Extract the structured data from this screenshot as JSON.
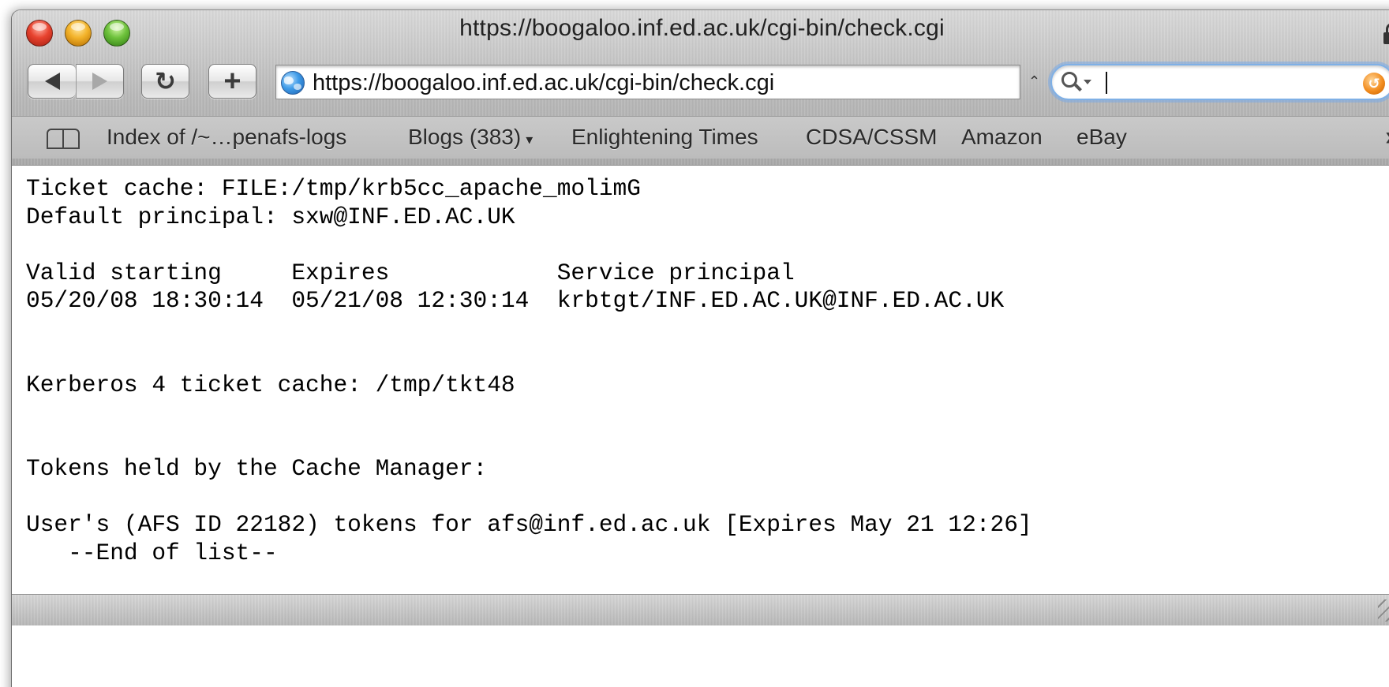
{
  "window": {
    "title": "https://boogaloo.inf.ed.ac.uk/cgi-bin/check.cgi",
    "title_icon": "lock-icon"
  },
  "toolbar": {
    "back_icon": "arrow-left-icon",
    "forward_icon": "arrow-right-icon",
    "reload_label": "↻",
    "add_label": "+",
    "url": "https://boogaloo.inf.ed.ac.uk/cgi-bin/check.cgi",
    "url_icon": "globe-icon",
    "search_value": "",
    "search_icon": "magnifier-icon",
    "snapback_icon": "snapback-icon"
  },
  "bookmarks": {
    "icon": "book-icon",
    "items": [
      "Index of /~…penafs-logs",
      "Blogs (383)",
      "Enlightening Times",
      "CDSA/CSSM",
      "Amazon",
      "eBay"
    ],
    "blogs_dropdown": "▾",
    "overflow": "»"
  },
  "content": {
    "lines": [
      "Ticket cache: FILE:/tmp/krb5cc_apache_molimG",
      "Default principal: sxw@INF.ED.AC.UK",
      "",
      "Valid starting     Expires            Service principal",
      "05/20/08 18:30:14  05/21/08 12:30:14  krbtgt/INF.ED.AC.UK@INF.ED.AC.UK",
      "",
      "",
      "Kerberos 4 ticket cache: /tmp/tkt48",
      "",
      "",
      "Tokens held by the Cache Manager:",
      "",
      "User's (AFS ID 22182) tokens for afs@inf.ed.ac.uk [Expires May 21 12:26]",
      "   --End of list--"
    ]
  },
  "colors": {
    "search_focus_ring": "#7fb0e6",
    "close": "#e8432f",
    "minimize": "#f3b32a",
    "zoom": "#6ec23c"
  }
}
